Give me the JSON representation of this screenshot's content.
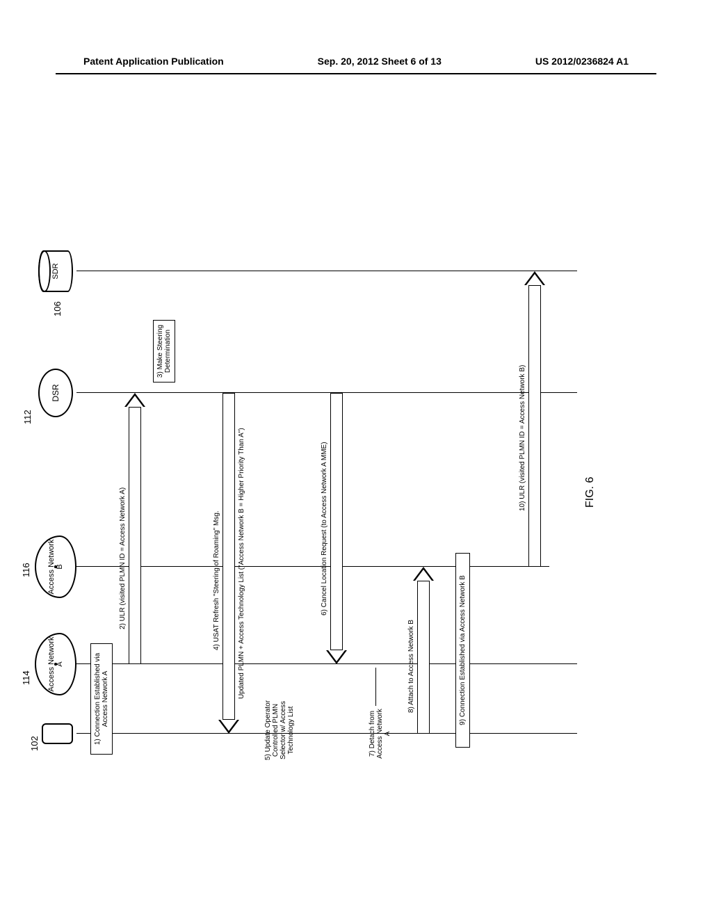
{
  "header": {
    "left": "Patent Application Publication",
    "center": "Sep. 20, 2012  Sheet 6 of 13",
    "right": "US 2012/0236824 A1"
  },
  "nodes": {
    "device_num": "102",
    "access_a": "Access Network A",
    "access_a_num": "114",
    "access_b": "Access Network B",
    "access_b_num": "116",
    "dsr": "DSR",
    "dsr_num": "112",
    "sdr": "SDR",
    "sdr_num": "106"
  },
  "steps": {
    "s1": "1) Connection Established via Access Network A",
    "s2": "2) ULR (visited PLMN ID = Access Network A)",
    "s3": "3) Make Steering Determination",
    "s4a": "4) USAT Refresh \"Steering of Roaming\" Msg.",
    "s4b": "Updated PLMN + Access Technology List (\"Access Network B = Higher Priority Than A\")",
    "s5": "5) Update Operator Controlled PLMN Selector w/ Access Technology List",
    "s6": "6) Cancel Location Request (to Access Network A MME)",
    "s7": "7) Detach from Access Network A",
    "s8": "8) Attach to Access Network B",
    "s9": "9) Connection Established via Access Network B",
    "s10": "10) ULR (visited PLMN ID = Access Network B)"
  },
  "figure": "FIG. 6"
}
